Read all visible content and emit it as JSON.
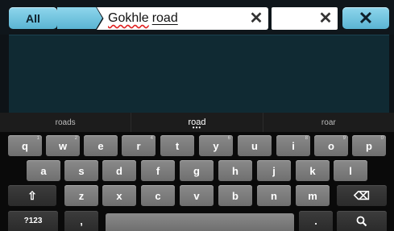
{
  "topbar": {
    "all_label": "All",
    "search_word1": "Gokhle",
    "search_word2": "road",
    "clear_glyph": "✕",
    "close_glyph": "✕"
  },
  "suggestions": [
    "roads",
    "road",
    "roar"
  ],
  "suggestion_dots": "•••",
  "keyboard": {
    "row1": [
      {
        "label": "q",
        "hint": "1"
      },
      {
        "label": "w",
        "hint": "2"
      },
      {
        "label": "e",
        "hint": ""
      },
      {
        "label": "r",
        "hint": "4"
      },
      {
        "label": "t",
        "hint": ""
      },
      {
        "label": "y",
        "hint": "6"
      },
      {
        "label": "u",
        "hint": ""
      },
      {
        "label": "i",
        "hint": "8"
      },
      {
        "label": "o",
        "hint": "9"
      },
      {
        "label": "p",
        "hint": "0"
      }
    ],
    "row2": [
      "a",
      "s",
      "d",
      "f",
      "g",
      "h",
      "j",
      "k",
      "l"
    ],
    "row3": [
      "z",
      "x",
      "c",
      "v",
      "b",
      "n",
      "m"
    ],
    "shift_glyph": "⇧",
    "backspace_glyph": "⌫",
    "symbols_label": "?123",
    "comma_label": ",",
    "period_label": ".",
    "search_glyph": "🔍"
  },
  "colors": {
    "accent": "#7cc8e2",
    "content_bg": "#102a33",
    "key_light": "#7d7d7d",
    "key_dark": "#343434"
  }
}
